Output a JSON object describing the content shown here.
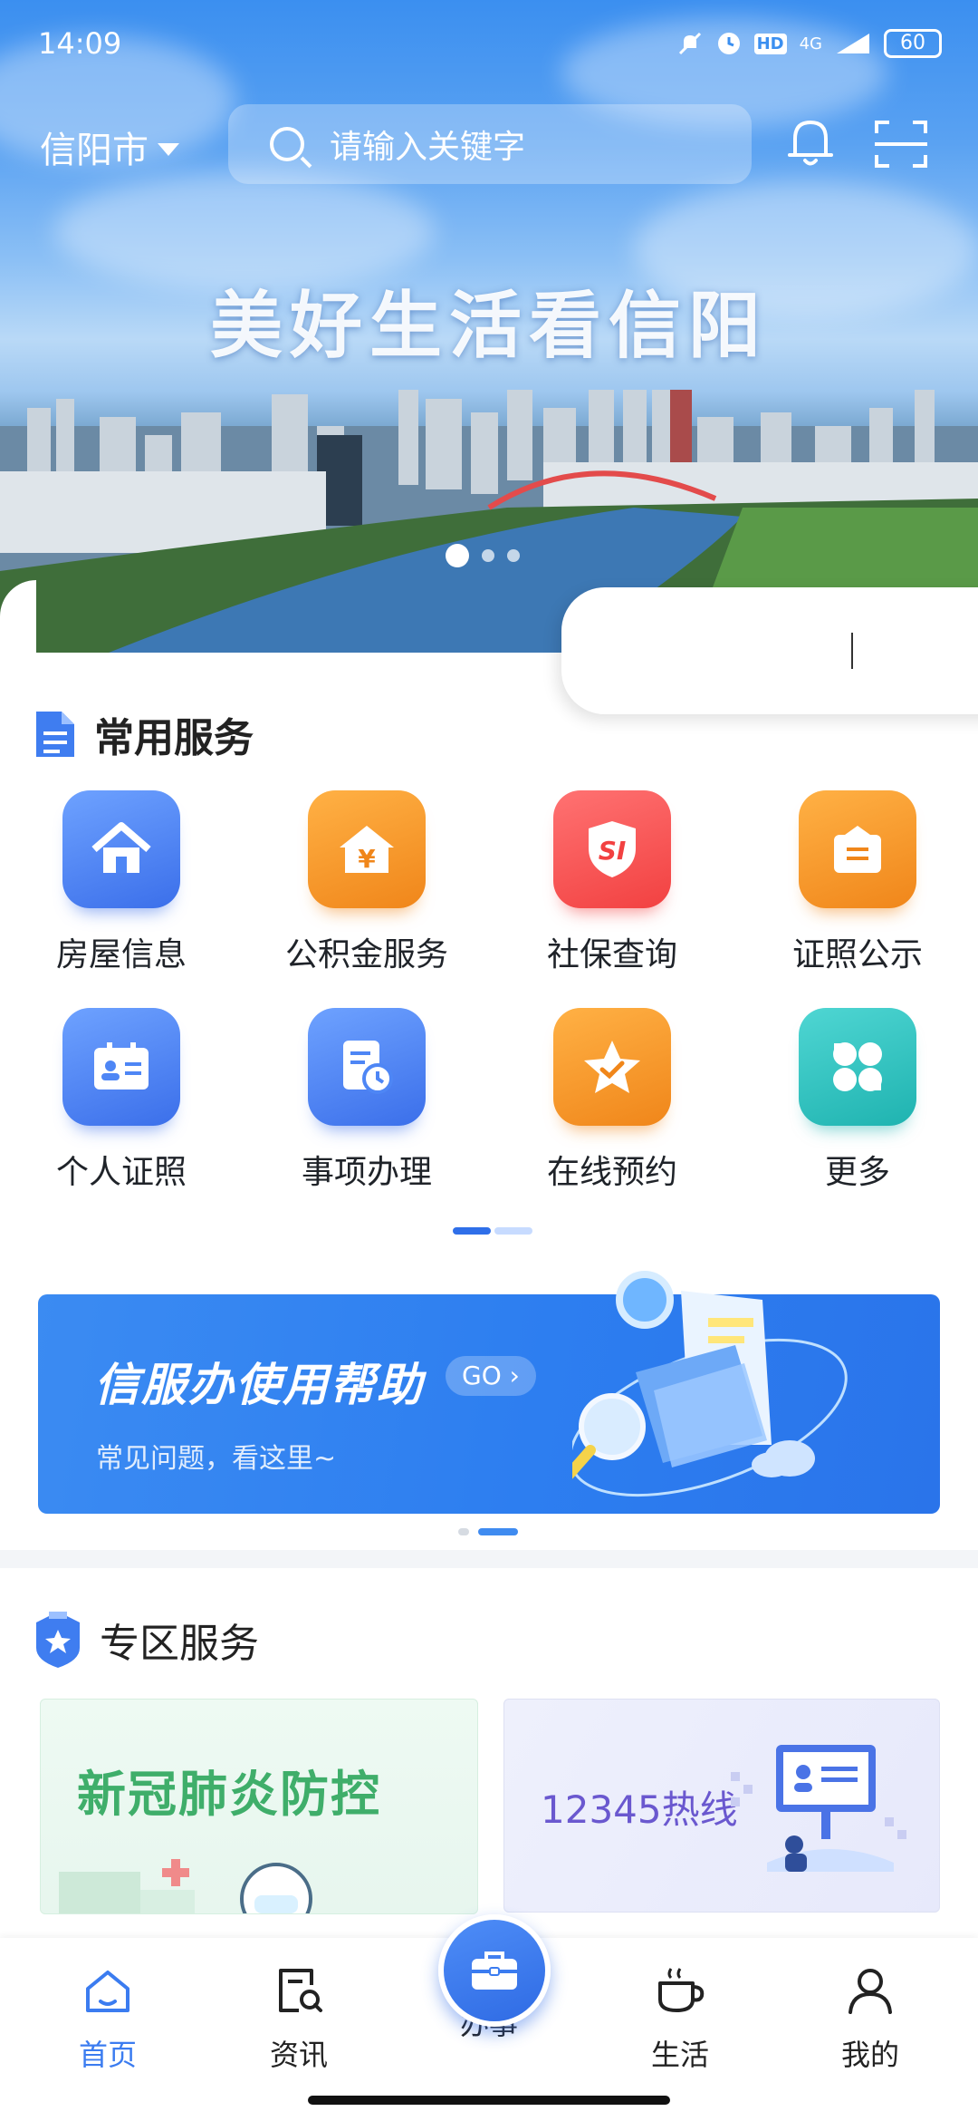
{
  "status_bar": {
    "time": "14:09",
    "battery": "60",
    "network": "4G",
    "hd": "HD"
  },
  "header": {
    "city": "信阳市",
    "search_placeholder": "请输入关键字"
  },
  "banner": {
    "slogan": "美好生活看信阳",
    "slide_count": 3,
    "active_slide": 1
  },
  "common_services": {
    "title": "常用服务",
    "items": [
      {
        "label": "房屋信息",
        "icon": "house-icon",
        "color": "#3b6fea"
      },
      {
        "label": "公积金服务",
        "icon": "fund-yuan-house-icon",
        "color": "#f0861a"
      },
      {
        "label": "社保查询",
        "icon": "social-security-shield-icon",
        "color": "#f24141"
      },
      {
        "label": "证照公示",
        "icon": "certificate-bag-icon",
        "color": "#f0861a"
      },
      {
        "label": "个人证照",
        "icon": "id-card-icon",
        "color": "#3b6fea"
      },
      {
        "label": "事项办理",
        "icon": "document-clock-icon",
        "color": "#3b6fea"
      },
      {
        "label": "在线预约",
        "icon": "star-check-icon",
        "color": "#f0861a"
      },
      {
        "label": "更多",
        "icon": "more-grid-icon",
        "color": "#1fb3b0"
      }
    ]
  },
  "help_banner": {
    "title": "信服办使用帮助",
    "go_label": "GO",
    "subtitle": "常见问题，看这里~"
  },
  "zone_services": {
    "title": "专区服务",
    "cards": [
      {
        "label": "新冠肺炎防控"
      },
      {
        "label": "12345热线"
      }
    ]
  },
  "tabbar": {
    "tabs": [
      {
        "label": "首页",
        "icon": "home-icon",
        "active": true
      },
      {
        "label": "资讯",
        "icon": "news-search-icon",
        "active": false
      },
      {
        "label": "办事",
        "icon": "briefcase-icon",
        "active": false
      },
      {
        "label": "生活",
        "icon": "coffee-cup-icon",
        "active": false
      },
      {
        "label": "我的",
        "icon": "user-icon",
        "active": false
      }
    ]
  },
  "colors": {
    "accent": "#3b7cf0",
    "text": "#1f2329"
  }
}
